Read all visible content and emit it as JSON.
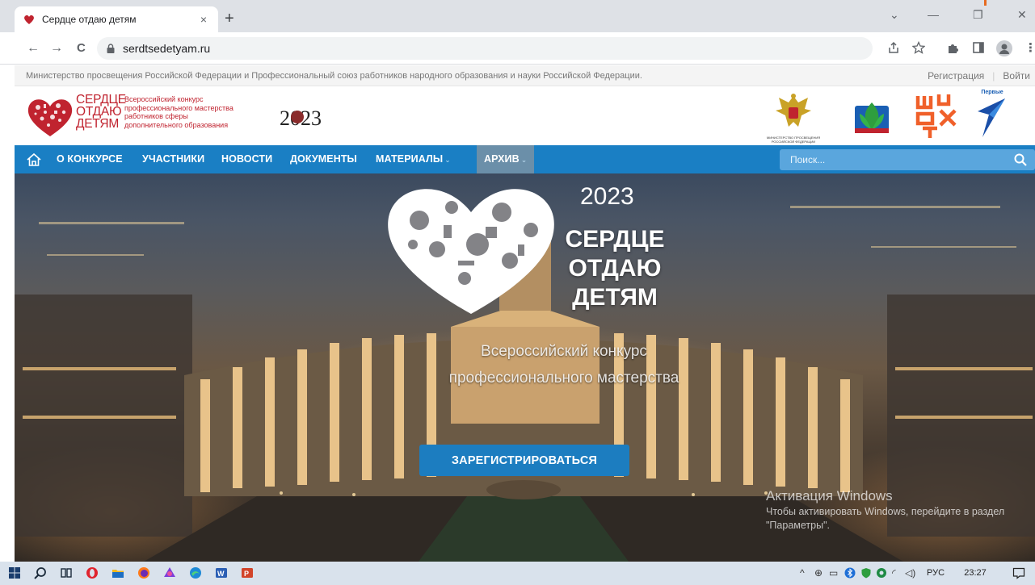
{
  "browser": {
    "tab_title": "Сердце отдаю детям",
    "tab_close": "×",
    "new_tab": "+",
    "url": "serdtsedetyam.ru",
    "window_controls": [
      "⌄",
      "—",
      "❐",
      "✕"
    ],
    "nav_back": "←",
    "nav_forward": "→",
    "nav_reload": "C"
  },
  "topstrip": {
    "ministry_text": "Министерство просвещения Российской Федерации и Профессиональный союз работников народного образования и науки Российской Федерации.",
    "register": "Регистрация",
    "login": "Войти"
  },
  "header": {
    "logo_lines": [
      "СЕРДЦЕ",
      "ОТДАЮ",
      "ДЕТЯМ"
    ],
    "logo_small_lines": [
      "Всероссийский конкурс",
      "профессионального мастерства",
      "работников сферы",
      "дополнительного образования"
    ],
    "year_logo": "2023",
    "ministry_caption": "МИНИСТЕРСТВО ПРОСВЕЩЕНИЯ РОССИЙСКОЙ ФЕДЕРАЦИИ",
    "pervye_label": "Первые"
  },
  "nav": {
    "items": [
      {
        "label": "О КОНКУРСЕ"
      },
      {
        "label": "УЧАСТНИКИ"
      },
      {
        "label": "НОВОСТИ"
      },
      {
        "label": "ДОКУМЕНТЫ"
      },
      {
        "label": "МАТЕРИАЛЫ"
      },
      {
        "label": "АРХИВ"
      }
    ],
    "search_placeholder": "Поиск..."
  },
  "hero": {
    "year": "2023",
    "title_lines": [
      "СЕРДЦЕ",
      "ОТДАЮ",
      "ДЕТЯМ"
    ],
    "subtitle_lines": [
      "Всероссийский конкурс",
      "профессионального мастерства"
    ],
    "button": "ЗАРЕГИСТРИРОВАТЬСЯ",
    "activation_title": "Активация Windows",
    "activation_text": "Чтобы активировать Windows, перейдите в раздел \"Параметры\"."
  },
  "taskbar": {
    "language": "РУС",
    "time": "23:27"
  },
  "colors": {
    "brand_red": "#c0232f",
    "nav_blue": "#1a7fc4",
    "active_nav": "#6b8fa9",
    "button_blue": "#1c7dc0"
  }
}
